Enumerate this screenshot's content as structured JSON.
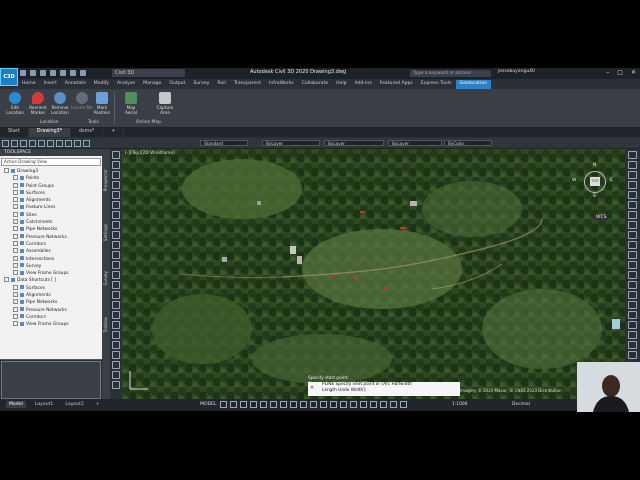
{
  "app": {
    "logo": "C3D",
    "workspace": "Civil 3D",
    "title": "Autodesk Civil 3D 2020   Drawing3.dwg",
    "search_placeholder": "Type a keyword or phrase",
    "user": "jessebuyangu40"
  },
  "ribbon_tabs": [
    "Home",
    "Insert",
    "Annotate",
    "Modify",
    "Analyze",
    "Manage",
    "Output",
    "Survey",
    "Rail",
    "Transparent",
    "InfraWorks",
    "Collaborate",
    "Help",
    "Add-ins",
    "Featured Apps",
    "Express Tools",
    "Geolocation"
  ],
  "ribbon": {
    "buttons": [
      {
        "label": "Edit Location",
        "icon": "globe-icon"
      },
      {
        "label": "Reorient Marker",
        "icon": "marker-icon"
      },
      {
        "label": "Remove Location",
        "icon": "remove-location-icon"
      },
      {
        "label": "Locate Me",
        "icon": "locate-icon"
      },
      {
        "label": "Mark Position",
        "icon": "pin-icon"
      },
      {
        "label": "Map Aerial",
        "icon": "map-icon"
      },
      {
        "label": "Capture Area",
        "icon": "capture-icon"
      }
    ],
    "groups": [
      "Location",
      "Tools",
      "Online Map"
    ]
  },
  "doc_tabs": [
    "Start",
    "Drawing3*",
    "dsms*",
    "+"
  ],
  "properties": {
    "text_style": "Standard",
    "layer": "ByLayer",
    "color": "ByLayer",
    "linetype": "ByLayer",
    "lineweight": "ByColor"
  },
  "toolspace": {
    "title": "TOOLSPACE",
    "view": "Active Drawing View",
    "tree": [
      {
        "label": "Drawing3",
        "level": 0
      },
      {
        "label": "Points",
        "level": 1
      },
      {
        "label": "Point Groups",
        "level": 1
      },
      {
        "label": "Surfaces",
        "level": 1
      },
      {
        "label": "Alignments",
        "level": 1
      },
      {
        "label": "Feature Lines",
        "level": 1
      },
      {
        "label": "Sites",
        "level": 1
      },
      {
        "label": "Catchments",
        "level": 1
      },
      {
        "label": "Pipe Networks",
        "level": 1
      },
      {
        "label": "Pressure Networks",
        "level": 1
      },
      {
        "label": "Corridors",
        "level": 1
      },
      {
        "label": "Assemblies",
        "level": 1
      },
      {
        "label": "Intersections",
        "level": 1
      },
      {
        "label": "Survey",
        "level": 1
      },
      {
        "label": "View Frame Groups",
        "level": 1
      },
      {
        "label": "Data Shortcuts [ ]",
        "level": 0
      },
      {
        "label": "Surfaces",
        "level": 1
      },
      {
        "label": "Alignments",
        "level": 1
      },
      {
        "label": "Pipe Networks",
        "level": 1
      },
      {
        "label": "Pressure Networks",
        "level": 1
      },
      {
        "label": "Corridors",
        "level": 1
      },
      {
        "label": "View Frame Groups",
        "level": 1
      }
    ],
    "side_tabs": [
      "Prospector",
      "Settings",
      "Survey",
      "Toolbox"
    ]
  },
  "viewport": {
    "label": "[-][Top][2D Wireframe]",
    "compass": {
      "n": "N",
      "w": "W",
      "e": "E",
      "s": "S"
    },
    "viewcube_face": "TOP",
    "wcs": "WCS"
  },
  "command": {
    "history": [
      "Specify start point:",
      "Current line-width is 0.0000"
    ],
    "prompt": "PLINE Specify next point or [Arc Halfwidth",
    "prompt2": "Length Undo Width]:"
  },
  "map_copyright": "Imagery © 2020 Maxar, © CNES 2020 Distribution",
  "status": {
    "layout_tabs": [
      "Model",
      "Layout1",
      "Layout2",
      "+"
    ],
    "model_label": "MODEL",
    "scale": "1:1000",
    "units": "Decimal"
  }
}
